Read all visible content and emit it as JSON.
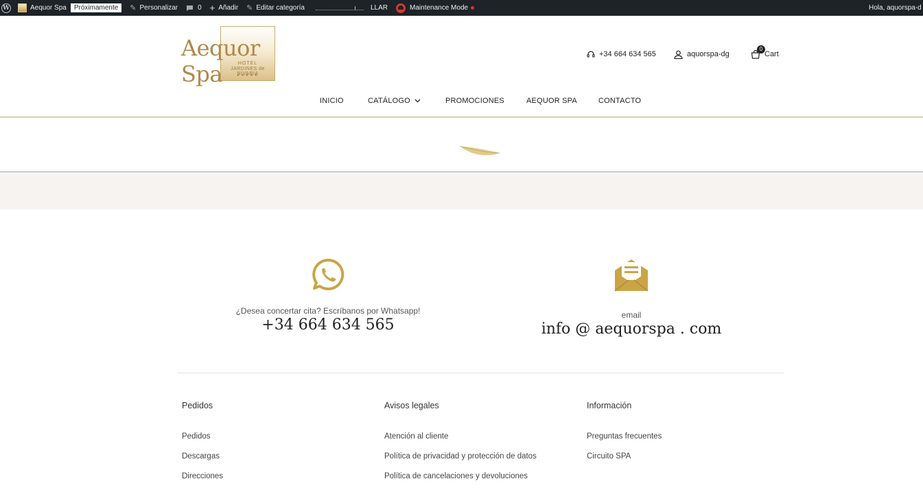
{
  "admin_bar": {
    "site_name": "Aequor Spa",
    "status_badge": "Próximamente",
    "customize": "Personalizar",
    "comments_count": "0",
    "add_new": "Añadir",
    "edit_category": "Editar categoría",
    "llar": "LLAR",
    "maintenance": "Maintenance Mode",
    "greeting": "Hola, aquorspa-d"
  },
  "header": {
    "logo": {
      "brand": "Aequor Spa",
      "line1": "HOTEL",
      "line2": "JARDINES de NIVARIA",
      "stars": "★★★★★"
    },
    "phone": "+34 664 634 565",
    "account": "aquorspa-dg",
    "cart_label": "Cart",
    "cart_count": "0"
  },
  "nav": {
    "items": [
      {
        "label": "INICIO"
      },
      {
        "label": "CATÁLOGO"
      },
      {
        "label": "PROMOCIONES"
      },
      {
        "label": "AEQUOR SPA"
      },
      {
        "label": "CONTACTO"
      }
    ]
  },
  "contact": {
    "whatsapp": {
      "caption": "¿Desea concertar cita? Escríbanos por Whatsapp!",
      "value": "+34 664 634 565"
    },
    "email": {
      "caption": "email",
      "value": "info @ aequorspa . com"
    }
  },
  "footer": {
    "columns": [
      {
        "heading": "Pedidos",
        "links": [
          "Pedidos",
          "Descargas",
          "Direcciones"
        ]
      },
      {
        "heading": "Avisos legales",
        "links": [
          "Atención al cliente",
          "Política de privacidad y protección de datos",
          "Política de cancelaciones y devoluciones"
        ]
      },
      {
        "heading": "Información",
        "links": [
          "Preguntas frecuentes",
          "Circuito SPA"
        ]
      }
    ]
  },
  "colors": {
    "accent_gold": "#c9a545",
    "admin_bar": "#1d2327",
    "band": "#f6f3f1",
    "header_rule": "#b9a36a"
  },
  "icons": [
    "wordpress-icon",
    "site-icon",
    "brush-icon",
    "comment-icon",
    "plus-icon",
    "pencil-icon",
    "maintenance-icon",
    "headset-icon",
    "user-icon",
    "bag-icon",
    "chevron-down-icon",
    "feather-icon",
    "whatsapp-icon",
    "envelope-icon"
  ]
}
